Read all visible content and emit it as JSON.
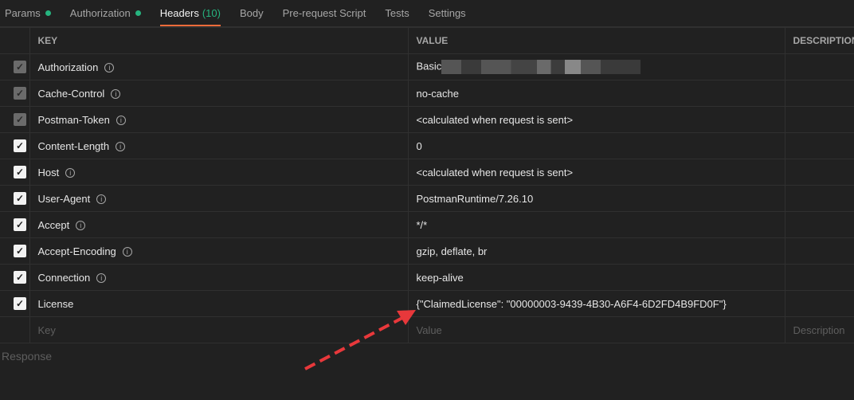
{
  "tabs": [
    {
      "label": "Params",
      "dot": true
    },
    {
      "label": "Authorization",
      "dot": true
    },
    {
      "label": "Headers",
      "count": "(10)",
      "active": true
    },
    {
      "label": "Body"
    },
    {
      "label": "Pre-request Script"
    },
    {
      "label": "Tests"
    },
    {
      "label": "Settings"
    }
  ],
  "columns": {
    "key": "KEY",
    "value": "VALUE",
    "description": "DESCRIPTION"
  },
  "rows": [
    {
      "key": "Authorization",
      "value": "Basic",
      "disabled": true,
      "redacted": true
    },
    {
      "key": "Cache-Control",
      "value": "no-cache",
      "disabled": true
    },
    {
      "key": "Postman-Token",
      "value": "<calculated when request is sent>",
      "disabled": true
    },
    {
      "key": "Content-Length",
      "value": "0"
    },
    {
      "key": "Host",
      "value": "<calculated when request is sent>"
    },
    {
      "key": "User-Agent",
      "value": "PostmanRuntime/7.26.10"
    },
    {
      "key": "Accept",
      "value": "*/*"
    },
    {
      "key": "Accept-Encoding",
      "value": "gzip, deflate, br"
    },
    {
      "key": "Connection",
      "value": "keep-alive"
    },
    {
      "key": "License",
      "value": "{\"ClaimedLicense\": \"00000003-9439-4B30-A6F4-6D2FD4B9FD0F\"}",
      "noinfo": true
    }
  ],
  "placeholders": {
    "key": "Key",
    "value": "Value",
    "description": "Description"
  },
  "response_label": "Response",
  "colors": {
    "accent": "#f26b3a",
    "green": "#26b47f",
    "arrow": "#e8383b"
  }
}
